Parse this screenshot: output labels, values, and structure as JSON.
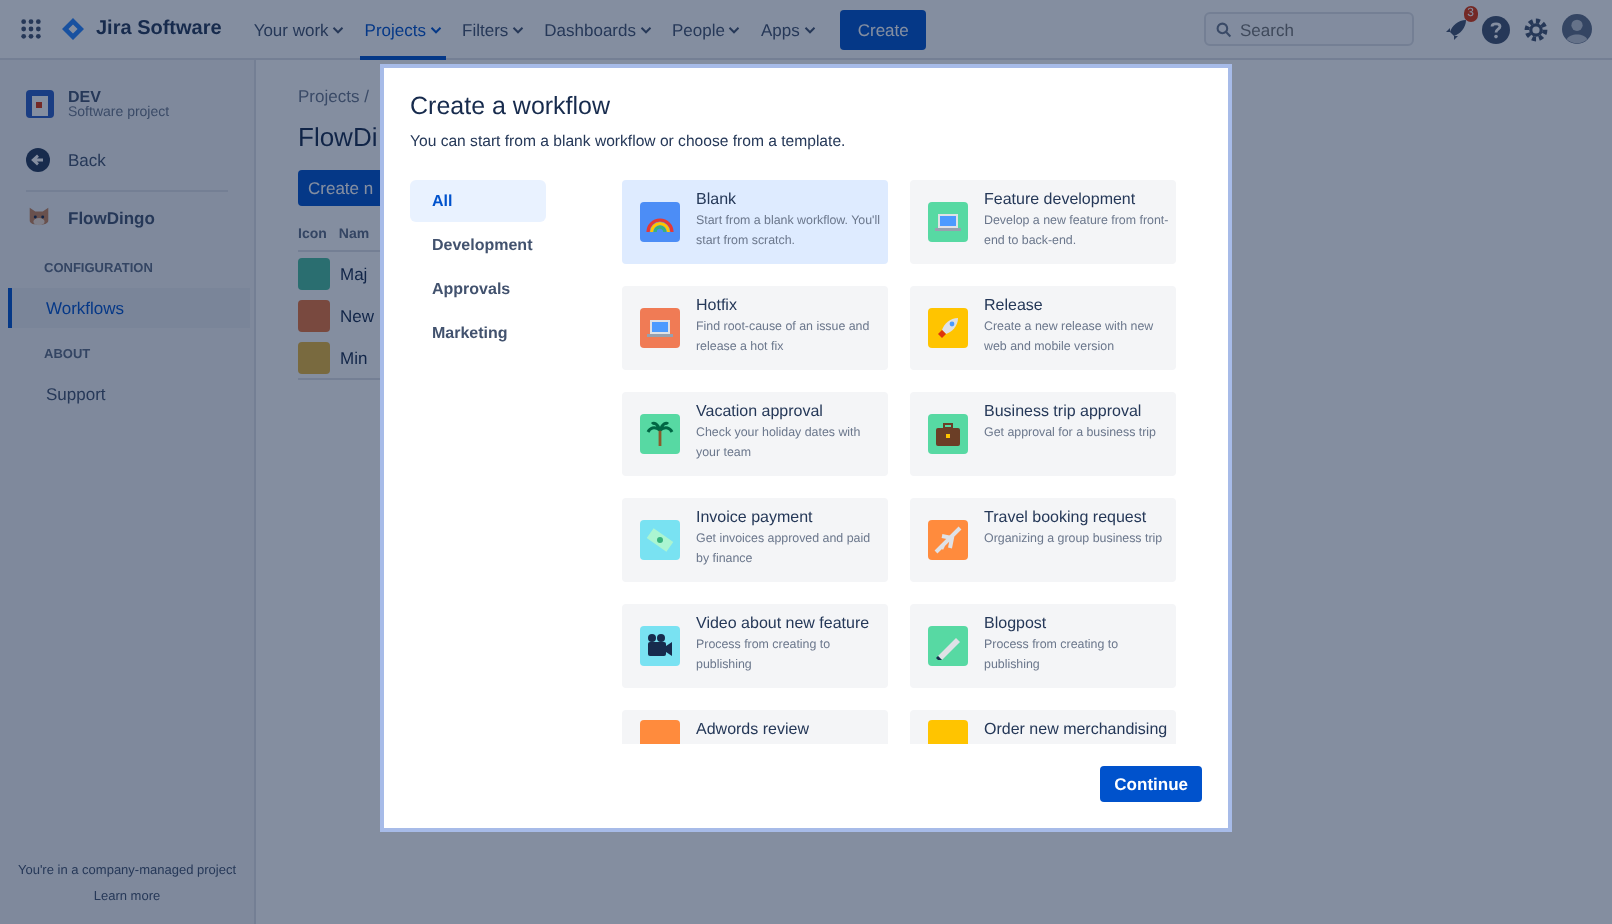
{
  "nav": {
    "product": "Jira Software",
    "menus": [
      {
        "label": "Your work",
        "selected": false
      },
      {
        "label": "Projects",
        "selected": true
      },
      {
        "label": "Filters",
        "selected": false
      },
      {
        "label": "Dashboards",
        "selected": false
      },
      {
        "label": "People",
        "selected": false
      },
      {
        "label": "Apps",
        "selected": false
      }
    ],
    "create": "Create",
    "search": {
      "placeholder": "Search"
    },
    "notifications": "3"
  },
  "sidebar": {
    "project": {
      "name": "DEV",
      "type": "Software project"
    },
    "back": "Back",
    "app": "FlowDingo",
    "sections": [
      {
        "heading": "CONFIGURATION",
        "items": [
          {
            "label": "Workflows",
            "selected": true
          }
        ]
      },
      {
        "heading": "ABOUT",
        "items": [
          {
            "label": "Support",
            "selected": false
          }
        ]
      }
    ],
    "footer": {
      "text": "You're in a company-managed project",
      "link": "Learn more"
    }
  },
  "content": {
    "breadcrumb": "Projects /",
    "title": "FlowDi",
    "button": "Create n",
    "columns": [
      "Icon",
      "Nam"
    ],
    "rows": [
      {
        "name": "Maj",
        "color": "#2a6e70"
      },
      {
        "name": "New",
        "color": "#79493f"
      },
      {
        "name": "Min",
        "color": "#796a3f"
      }
    ]
  },
  "modal": {
    "title": "Create a workflow",
    "subtitle": "You can start from a blank workflow or choose from a template.",
    "categories": [
      {
        "label": "All",
        "selected": true
      },
      {
        "label": "Development",
        "selected": false
      },
      {
        "label": "Approvals",
        "selected": false
      },
      {
        "label": "Marketing",
        "selected": false
      }
    ],
    "templates": [
      {
        "title": "Blank",
        "description": "Start from a blank workflow. You'll start from scratch.",
        "color": "#4c8df6",
        "selected": true
      },
      {
        "title": "Feature development",
        "description": "Develop a new feature from front-end to back-end.",
        "color": "#57d9a3",
        "selected": false
      },
      {
        "title": "Hotfix",
        "description": "Find root-cause of an issue and release a hot fix",
        "color": "#f07b55",
        "selected": false
      },
      {
        "title": "Release",
        "description": "Create a new release with new web and mobile version",
        "color": "#ffc400",
        "selected": false
      },
      {
        "title": "Vacation approval",
        "description": "Check your holiday dates with your team",
        "color": "#57d9a3",
        "selected": false
      },
      {
        "title": "Business trip approval",
        "description": "Get approval for a business trip",
        "color": "#57d9a3",
        "selected": false
      },
      {
        "title": "Invoice payment",
        "description": "Get invoices approved and paid by finance",
        "color": "#79e2f2",
        "selected": false
      },
      {
        "title": "Travel booking request",
        "description": "Organizing a group business trip",
        "color": "#ff8b3d",
        "selected": false
      },
      {
        "title": "Video about new feature",
        "description": "Process from creating to publishing",
        "color": "#79e2f2",
        "selected": false
      },
      {
        "title": "Blogpost",
        "description": "Process from creating to publishing",
        "color": "#57d9a3",
        "selected": false
      },
      {
        "title": "Adwords review",
        "color": "#ff8b3d",
        "selected": false
      },
      {
        "title": "Order new merchandising",
        "color": "#ffc400",
        "selected": false
      }
    ],
    "continue": "Continue"
  }
}
